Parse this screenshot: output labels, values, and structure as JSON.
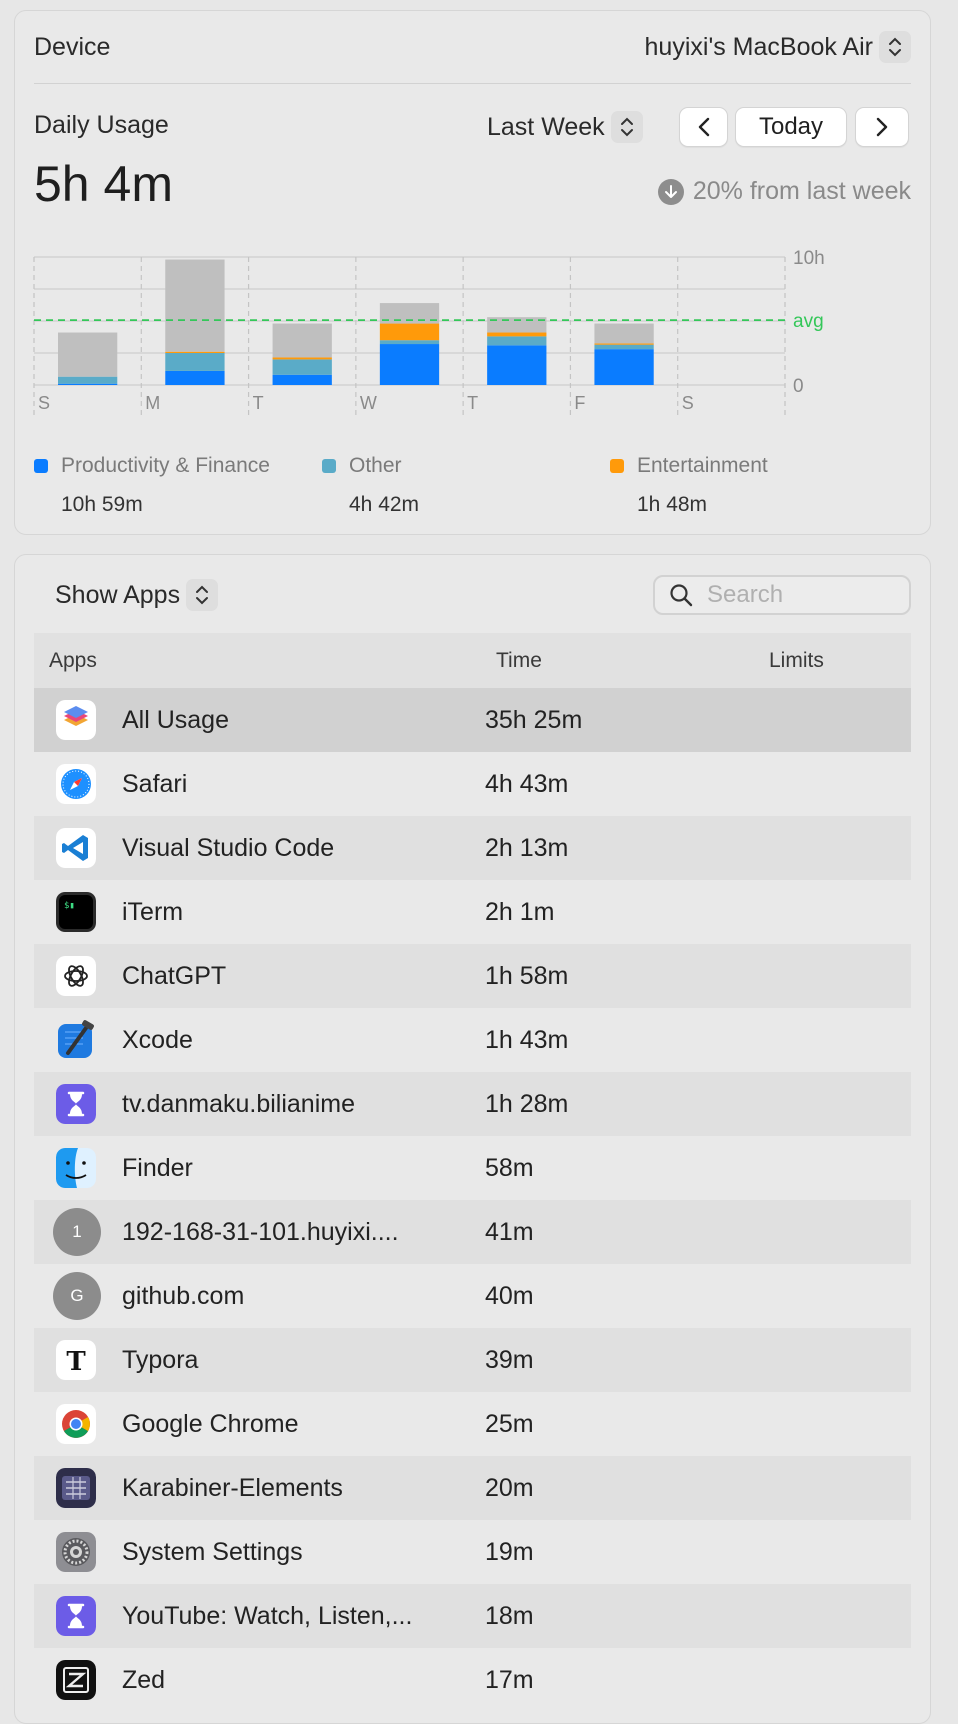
{
  "device": {
    "label": "Device",
    "value": "huyixi's MacBook Air"
  },
  "usage": {
    "title": "Daily Usage",
    "total": "5h 4m",
    "period": "Last Week",
    "today_label": "Today",
    "trend_text": "20% from last week"
  },
  "colors": {
    "productivity": "#0a7cff",
    "other": "#5aabc8",
    "entertainment": "#ff9a0a",
    "remaining": "#bfbfbf",
    "avg": "#34c759"
  },
  "chart_data": {
    "type": "bar",
    "stacked": true,
    "categories": [
      "S",
      "M",
      "T",
      "W",
      "T",
      "F",
      "S"
    ],
    "y_ticks": [
      "10h",
      "avg",
      "0"
    ],
    "ylim": [
      0,
      10
    ],
    "avg": 5.07,
    "series": [
      {
        "name": "Productivity & Finance",
        "values": [
          0.1,
          1.1,
          0.8,
          3.2,
          3.1,
          2.8,
          0
        ]
      },
      {
        "name": "Other",
        "values": [
          0.55,
          1.4,
          1.2,
          0.3,
          0.7,
          0.35,
          0
        ]
      },
      {
        "name": "Entertainment",
        "values": [
          0,
          0.1,
          0.15,
          1.3,
          0.3,
          0.1,
          0
        ]
      },
      {
        "name": "Remaining",
        "values": [
          3.45,
          7.2,
          2.65,
          1.6,
          1.2,
          1.55,
          0
        ]
      }
    ],
    "grid": true
  },
  "legend": [
    {
      "name": "Productivity & Finance",
      "total": "10h 59m"
    },
    {
      "name": "Other",
      "total": "4h 42m"
    },
    {
      "name": "Entertainment",
      "total": "1h 48m"
    }
  ],
  "apps_panel": {
    "filter": "Show Apps",
    "search_placeholder": "Search",
    "columns": [
      "Apps",
      "Time",
      "Limits"
    ],
    "rows": [
      {
        "name": "All Usage",
        "time": "35h 25m",
        "icon": "layers-icon"
      },
      {
        "name": "Safari",
        "time": "4h 43m",
        "icon": "safari-icon"
      },
      {
        "name": "Visual Studio Code",
        "time": "2h 13m",
        "icon": "vscode-icon"
      },
      {
        "name": "iTerm",
        "time": "2h 1m",
        "icon": "iterm-icon"
      },
      {
        "name": "ChatGPT",
        "time": "1h 58m",
        "icon": "chatgpt-icon"
      },
      {
        "name": "Xcode",
        "time": "1h 43m",
        "icon": "xcode-icon"
      },
      {
        "name": "tv.danmaku.bilianime",
        "time": "1h 28m",
        "icon": "hourglass-icon"
      },
      {
        "name": "Finder",
        "time": "58m",
        "icon": "finder-icon"
      },
      {
        "name": "192-168-31-101.huyixi....",
        "time": "41m",
        "icon": "letter-icon",
        "letter": "1"
      },
      {
        "name": "github.com",
        "time": "40m",
        "icon": "letter-icon",
        "letter": "G"
      },
      {
        "name": "Typora",
        "time": "39m",
        "icon": "typora-icon"
      },
      {
        "name": "Google Chrome",
        "time": "25m",
        "icon": "chrome-icon"
      },
      {
        "name": "Karabiner-Elements",
        "time": "20m",
        "icon": "karabiner-icon"
      },
      {
        "name": "System Settings",
        "time": "19m",
        "icon": "settings-icon"
      },
      {
        "name": "YouTube: Watch, Listen,...",
        "time": "18m",
        "icon": "hourglass-icon"
      },
      {
        "name": "Zed",
        "time": "17m",
        "icon": "zed-icon"
      }
    ]
  }
}
